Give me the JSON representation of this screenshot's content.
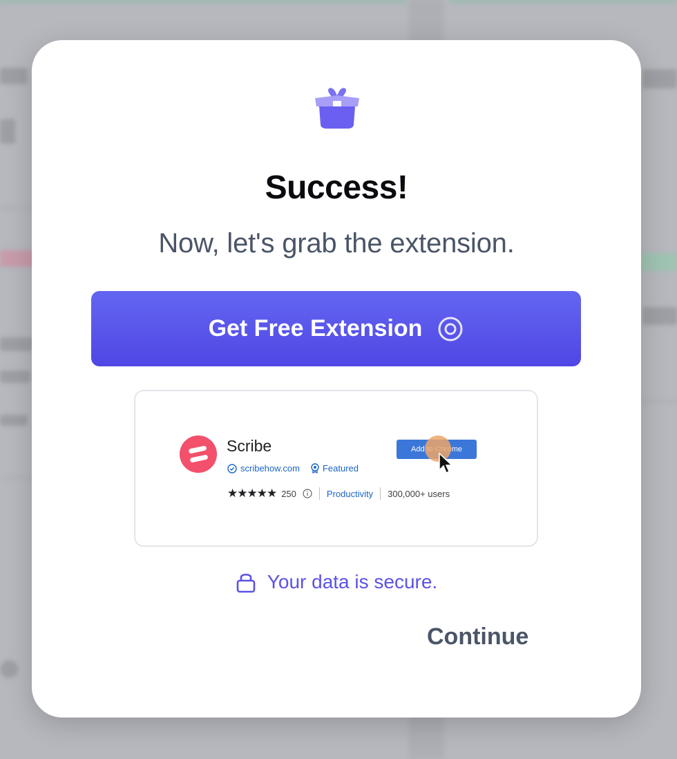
{
  "modal": {
    "title": "Success!",
    "subtitle": "Now, let's grab the extension.",
    "cta_label": "Get Free Extension",
    "secure_text": "Your data is secure.",
    "continue_label": "Continue"
  },
  "preview": {
    "app_name": "Scribe",
    "domain": "scribehow.com",
    "badge": "Featured",
    "rating_stars": "★★★★★",
    "rating_count": "250",
    "category": "Productivity",
    "users": "300,000+ users",
    "add_button_label": "Add to Chrome"
  },
  "colors": {
    "accent": "#5046e5",
    "secure_text": "#5b52e6",
    "scribe_logo": "#f2506b"
  },
  "icons": [
    "gift-box-icon",
    "target-icon",
    "verified-icon",
    "featured-badge-icon",
    "info-icon",
    "lock-icon",
    "cursor-icon"
  ]
}
